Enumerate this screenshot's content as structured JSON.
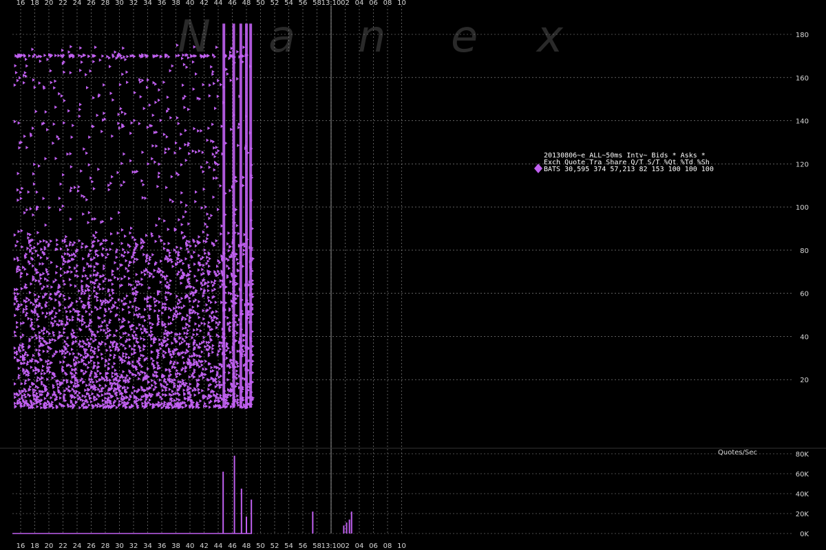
{
  "watermark": [
    "N",
    "a",
    "n",
    "e",
    "x"
  ],
  "legend": {
    "title": "20130806~e_ALL~50ms Intv~ Bids * Asks *",
    "header": "Exch  Quote Tra  Share  Q/T   S/T  %Qt %Td %Sh",
    "row": "BATS 30,595 374 57,213    82   153 100 100 100"
  },
  "volume_label": "Quotes/Sec",
  "colors": {
    "series": "#c060f0",
    "background": "#000000",
    "grid": "#9a9a9a"
  },
  "chart_data": [
    {
      "type": "scatter",
      "x_ticks": [
        "16",
        "18",
        "20",
        "22",
        "24",
        "26",
        "28",
        "30",
        "32",
        "34",
        "36",
        "38",
        "40",
        "42",
        "44",
        "46",
        "48",
        "50",
        "52",
        "54",
        "56",
        "58",
        "13:10",
        "02",
        "04",
        "06",
        "08",
        "10"
      ],
      "y_ticks": [
        20,
        40,
        60,
        80,
        100,
        120,
        140,
        160,
        180
      ],
      "ylim": [
        0,
        190
      ],
      "grid": true,
      "series": [
        {
          "name": "BATS",
          "color": "#c060f0"
        }
      ],
      "bursts_at_x_tick_index": [
        14.4,
        15.1,
        15.6,
        16.0,
        16.3
      ],
      "dense_region_y": [
        7,
        85
      ],
      "sparse_region_y": [
        85,
        175
      ]
    },
    {
      "type": "bar",
      "ylabel": "Quotes/Sec",
      "y_ticks": [
        "0K",
        "20K",
        "40K",
        "60K",
        "80K"
      ],
      "ylim": [
        0,
        80000
      ],
      "spikes": [
        {
          "x_tick": 14.35,
          "value": 62000
        },
        {
          "x_tick": 15.15,
          "value": 78000
        },
        {
          "x_tick": 15.65,
          "value": 45000
        },
        {
          "x_tick": 16.0,
          "value": 17000
        },
        {
          "x_tick": 16.35,
          "value": 34000
        },
        {
          "x_tick": 20.7,
          "value": 22000
        },
        {
          "x_tick": 22.9,
          "value": 8000
        },
        {
          "x_tick": 23.1,
          "value": 11000
        },
        {
          "x_tick": 23.3,
          "value": 14000
        },
        {
          "x_tick": 23.45,
          "value": 22000
        }
      ]
    }
  ]
}
